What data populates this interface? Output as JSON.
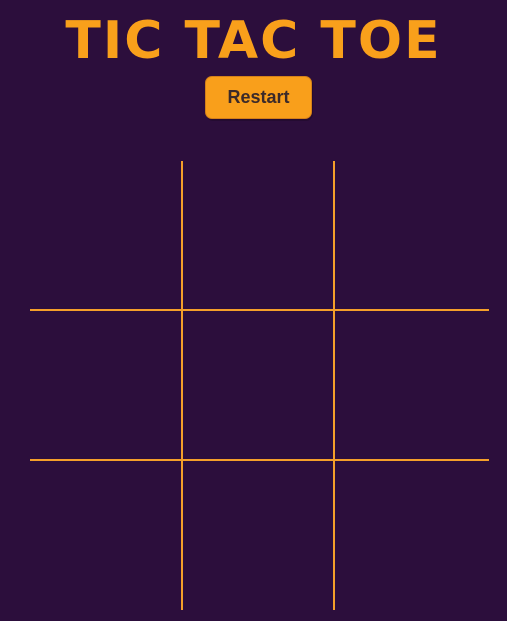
{
  "title": "TIC TAC TOE",
  "restart_label": "Restart",
  "colors": {
    "background": "#2c0e3c",
    "accent": "#f9a01b",
    "grid": "#f59f2a",
    "button_text": "#3b2a2a"
  },
  "board": {
    "cells": [
      "",
      "",
      "",
      "",
      "",
      "",
      "",
      "",
      ""
    ]
  }
}
